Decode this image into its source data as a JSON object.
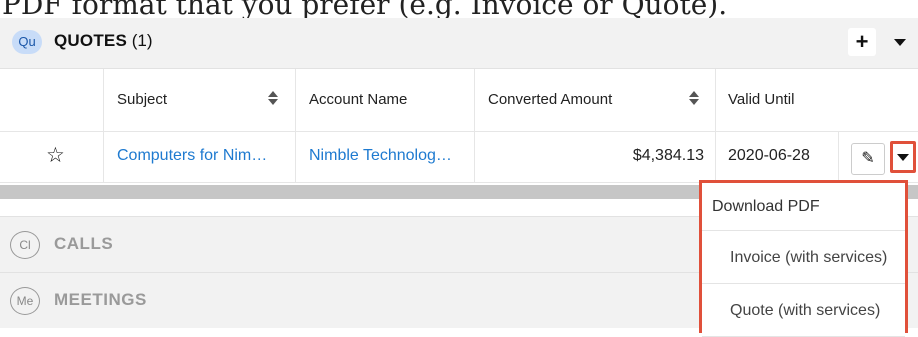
{
  "instruction_text": "PDF format that you prefer (e.g. Invoice or Quote).",
  "quotes_panel": {
    "badge": "Qu",
    "title": "QUOTES",
    "count": "(1)",
    "add_icon": "plus-icon",
    "menu_icon": "caret-down-icon"
  },
  "columns": [
    {
      "label": "Subject",
      "sortable": true
    },
    {
      "label": "Account Name",
      "sortable": false
    },
    {
      "label": "Converted Amount",
      "sortable": true
    },
    {
      "label": "Valid Until",
      "sortable": false
    }
  ],
  "rows": [
    {
      "favorite_icon": "star-outline-icon",
      "subject": "Computers for Nim…",
      "account_name": "Nimble Technolog…",
      "converted_amount": "$4,384.13",
      "valid_until": "2020-06-28",
      "edit_icon": "pencil-icon",
      "actions_icon": "caret-down-icon"
    }
  ],
  "subpanels": [
    {
      "badge": "Cl",
      "label": "CALLS"
    },
    {
      "badge": "Me",
      "label": "MEETINGS"
    }
  ],
  "dropdown": {
    "header": "Download PDF",
    "items": [
      "Invoice (with services)",
      "Quote (with services)"
    ],
    "highlight_color": "#e0503a"
  },
  "colors": {
    "link": "#1e7ad0",
    "panel_bg": "#f2f2f2",
    "badge_bg": "#c8dcf8"
  }
}
